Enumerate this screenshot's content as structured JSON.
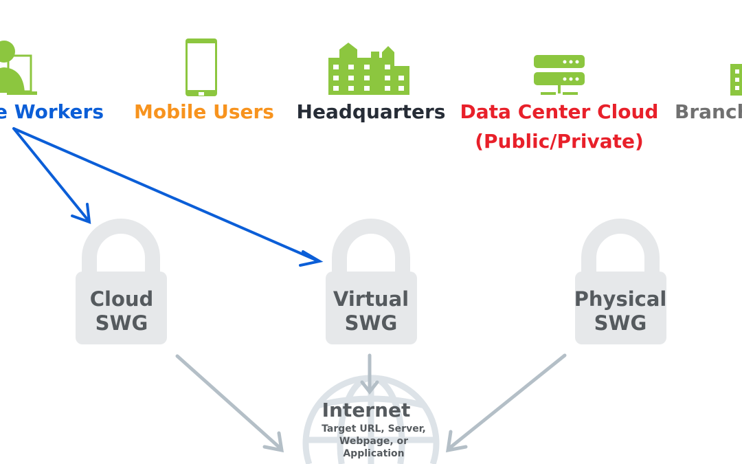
{
  "sources": [
    {
      "label": "e Workers",
      "color": "#0b5ed7",
      "icon": "remote-worker-icon"
    },
    {
      "label": "Mobile Users",
      "color": "#f7931e",
      "icon": "mobile-phone-icon"
    },
    {
      "label": "Headquarters",
      "color": "#262c36",
      "icon": "buildings-icon"
    },
    {
      "label": "Data Center Cloud",
      "label2": "(Public/Private)",
      "color": "#e8202a",
      "icon": "server-icon"
    },
    {
      "label": "Branch",
      "color": "#707070",
      "icon": "building-icon"
    }
  ],
  "gateways": [
    {
      "line1": "Cloud",
      "line2": "SWG",
      "icon": "lock-icon"
    },
    {
      "line1": "Virtual",
      "line2": "SWG",
      "icon": "lock-icon"
    },
    {
      "line1": "Physical",
      "line2": "SWG",
      "icon": "lock-icon"
    }
  ],
  "internet": {
    "title": "Internet",
    "line1": "Target URL, Server,",
    "line2": "Webpage, or",
    "line3": "Application",
    "icon": "globe-icon"
  },
  "colors": {
    "icon_green": "#8cc63f",
    "lock_grey": "#e6e8ea",
    "arrow_blue": "#0b5ed7",
    "arrow_grey": "#b4bfc7"
  }
}
